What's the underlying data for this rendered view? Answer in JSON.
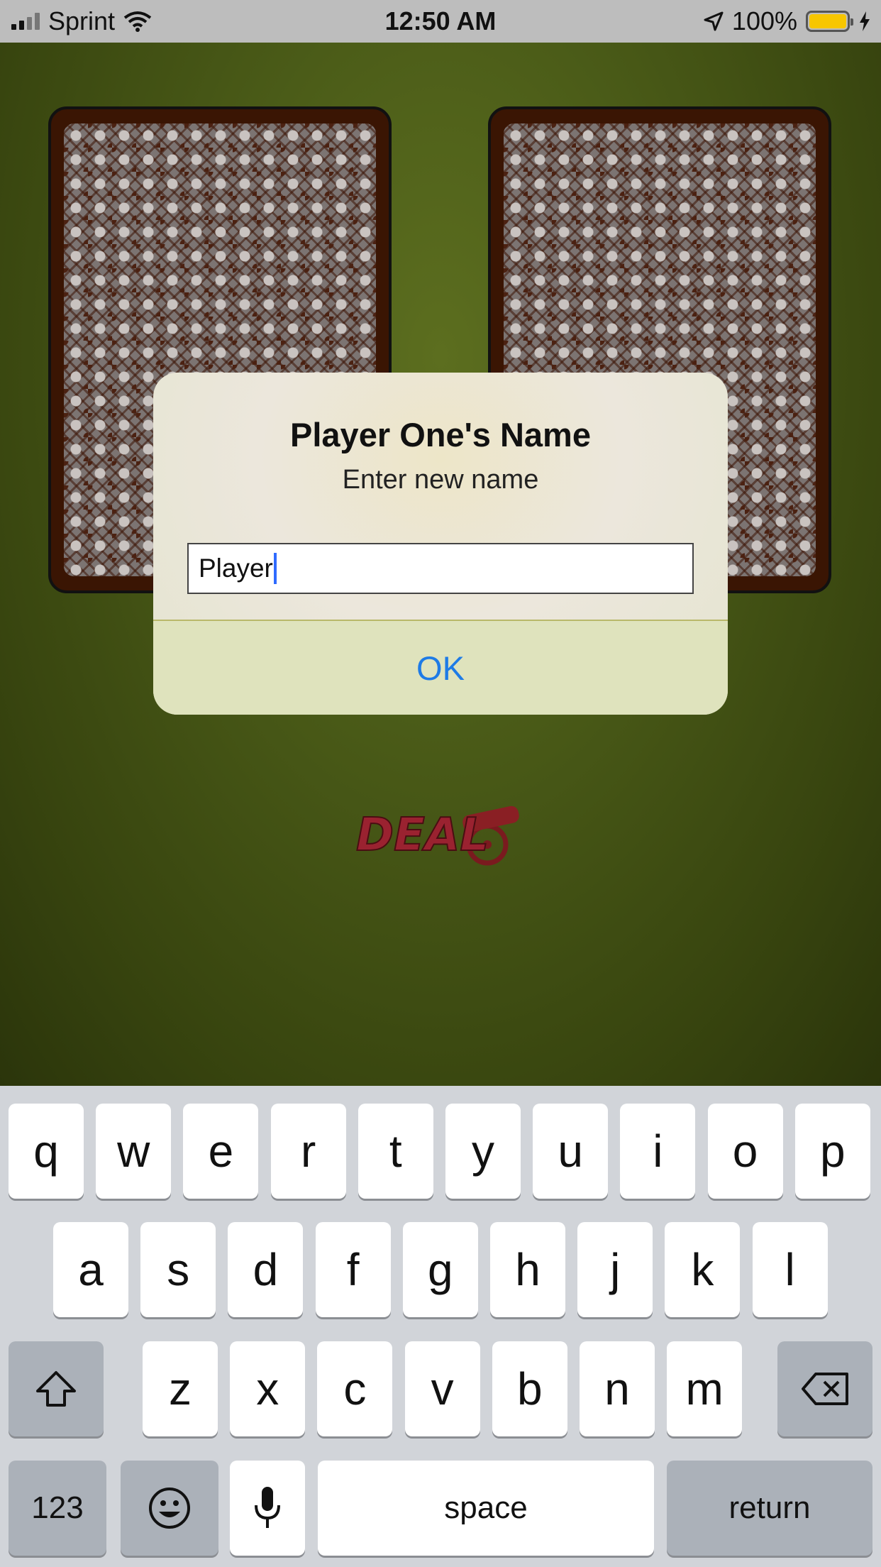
{
  "status_bar": {
    "carrier": "Sprint",
    "time": "12:50 AM",
    "battery_percent": "100%",
    "battery_level": 1.0,
    "signal_bars_filled": 2,
    "signal_bars_total": 4,
    "icons": [
      "signal-bars-icon",
      "wifi-icon",
      "location-arrow-icon",
      "battery-icon",
      "charging-bolt-icon"
    ]
  },
  "game": {
    "logo_text": "DEAL",
    "card_back_color": "#3a1503",
    "felt_color": "#4b5c18"
  },
  "dialog": {
    "title": "Player One's Name",
    "subtitle": "Enter new name",
    "input_value": "Player",
    "ok_label": "OK",
    "ok_color": "#1e7be6"
  },
  "keyboard": {
    "row1": [
      "q",
      "w",
      "e",
      "r",
      "t",
      "y",
      "u",
      "i",
      "o",
      "p"
    ],
    "row2": [
      "a",
      "s",
      "d",
      "f",
      "g",
      "h",
      "j",
      "k",
      "l"
    ],
    "row3": [
      "z",
      "x",
      "c",
      "v",
      "b",
      "n",
      "m"
    ],
    "numbers_label": "123",
    "space_label": "space",
    "return_label": "return",
    "icons": [
      "shift-icon",
      "delete-icon",
      "emoji-icon",
      "microphone-icon"
    ]
  }
}
